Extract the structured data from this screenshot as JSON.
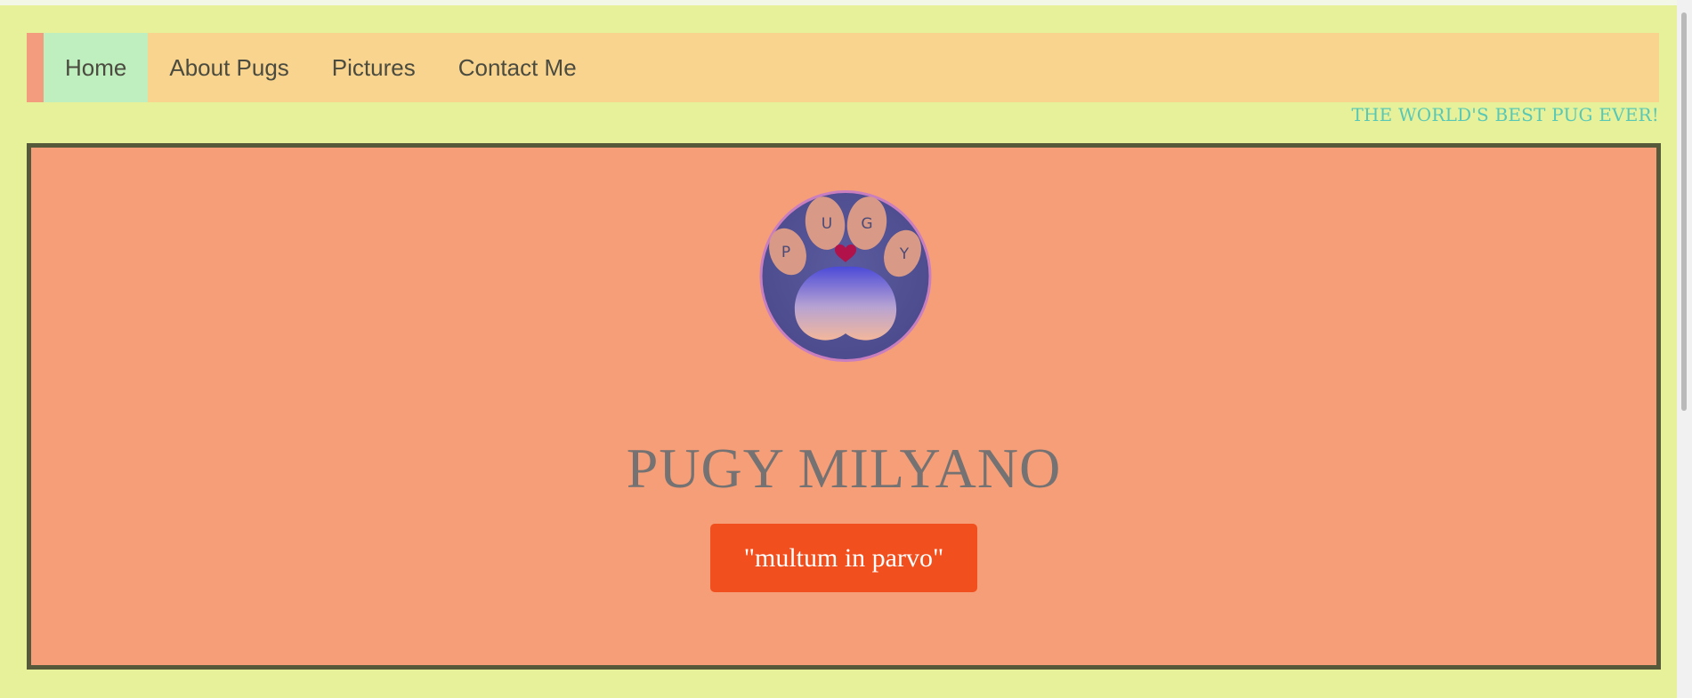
{
  "nav": {
    "items": [
      {
        "label": "Home",
        "active": true
      },
      {
        "label": "About Pugs",
        "active": false
      },
      {
        "label": "Pictures",
        "active": false
      },
      {
        "label": "Contact Me",
        "active": false
      }
    ]
  },
  "tagline": "THE WORLD'S BEST PUG EVER!",
  "hero": {
    "logo": {
      "letters": [
        "P",
        "U",
        "G",
        "Y"
      ]
    },
    "title": "PUGY MILYANO",
    "motto": "\"multum in parvo\""
  },
  "colors": {
    "page_background": "#e6f19a",
    "nav_background": "#f8d48e",
    "nav_active": "#bfeebf",
    "nav_accent": "#f49c7e",
    "tagline": "#58c8b6",
    "hero_background": "#f59e78",
    "hero_border": "#565a3a",
    "motto_button": "#f14f1d"
  }
}
